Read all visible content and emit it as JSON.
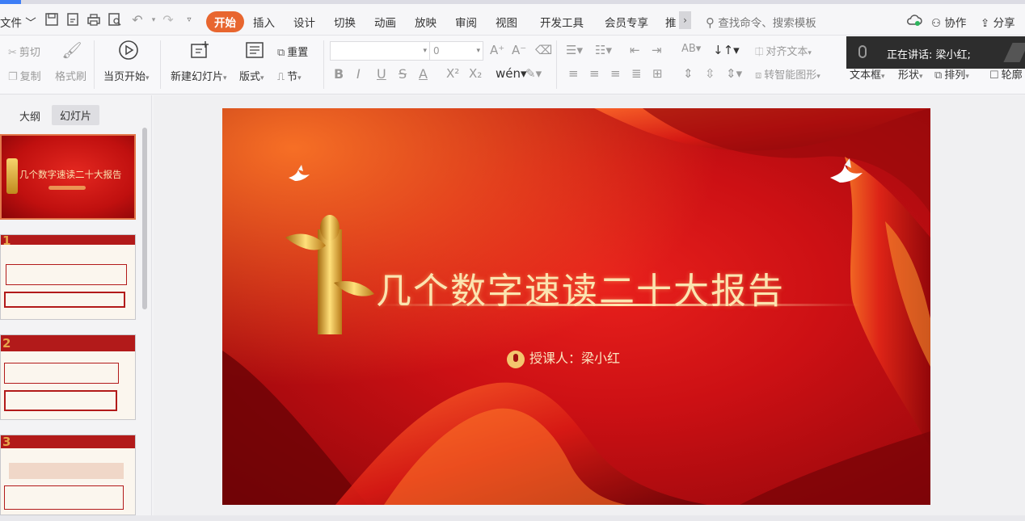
{
  "menu": {
    "file": "文件",
    "tabs": [
      {
        "label": "开始",
        "active": true
      },
      {
        "label": "插入"
      },
      {
        "label": "设计"
      },
      {
        "label": "切换"
      },
      {
        "label": "动画"
      },
      {
        "label": "放映"
      },
      {
        "label": "审阅"
      },
      {
        "label": "视图"
      },
      {
        "label": "开发工具"
      },
      {
        "label": "会员专享"
      },
      {
        "label": "推"
      }
    ],
    "search_placeholder": "查找命令、搜索模板",
    "collab": "协作",
    "share": "分享"
  },
  "ribbon": {
    "cut": "剪切",
    "copy": "复制",
    "format_painter": "格式刷",
    "play_from_current": "当页开始",
    "new_slide": "新建幻灯片",
    "layout": "版式",
    "reset": "重置",
    "section": "节",
    "font_size": "0",
    "align_text": "对齐文本",
    "smartart": "转智能图形",
    "textbox": "文本框",
    "shape": "形状",
    "arrange": "排列",
    "outline": "轮廓"
  },
  "tooltip": {
    "text": "正在讲话: 梁小红;"
  },
  "left_panel": {
    "tab_outline": "大纲",
    "tab_slides": "幻灯片",
    "thumb1_title": "几个数字速读二十大报告",
    "thumb2_number": "1",
    "thumb3_number": "2",
    "thumb4_number": "3"
  },
  "slide": {
    "title": "几个数字速读二十大报告",
    "lecturer": "授课人：梁小红"
  },
  "colors": {
    "accent": "#e8662f",
    "slide_red": "#cc1014",
    "gold": "#f3c66e"
  }
}
